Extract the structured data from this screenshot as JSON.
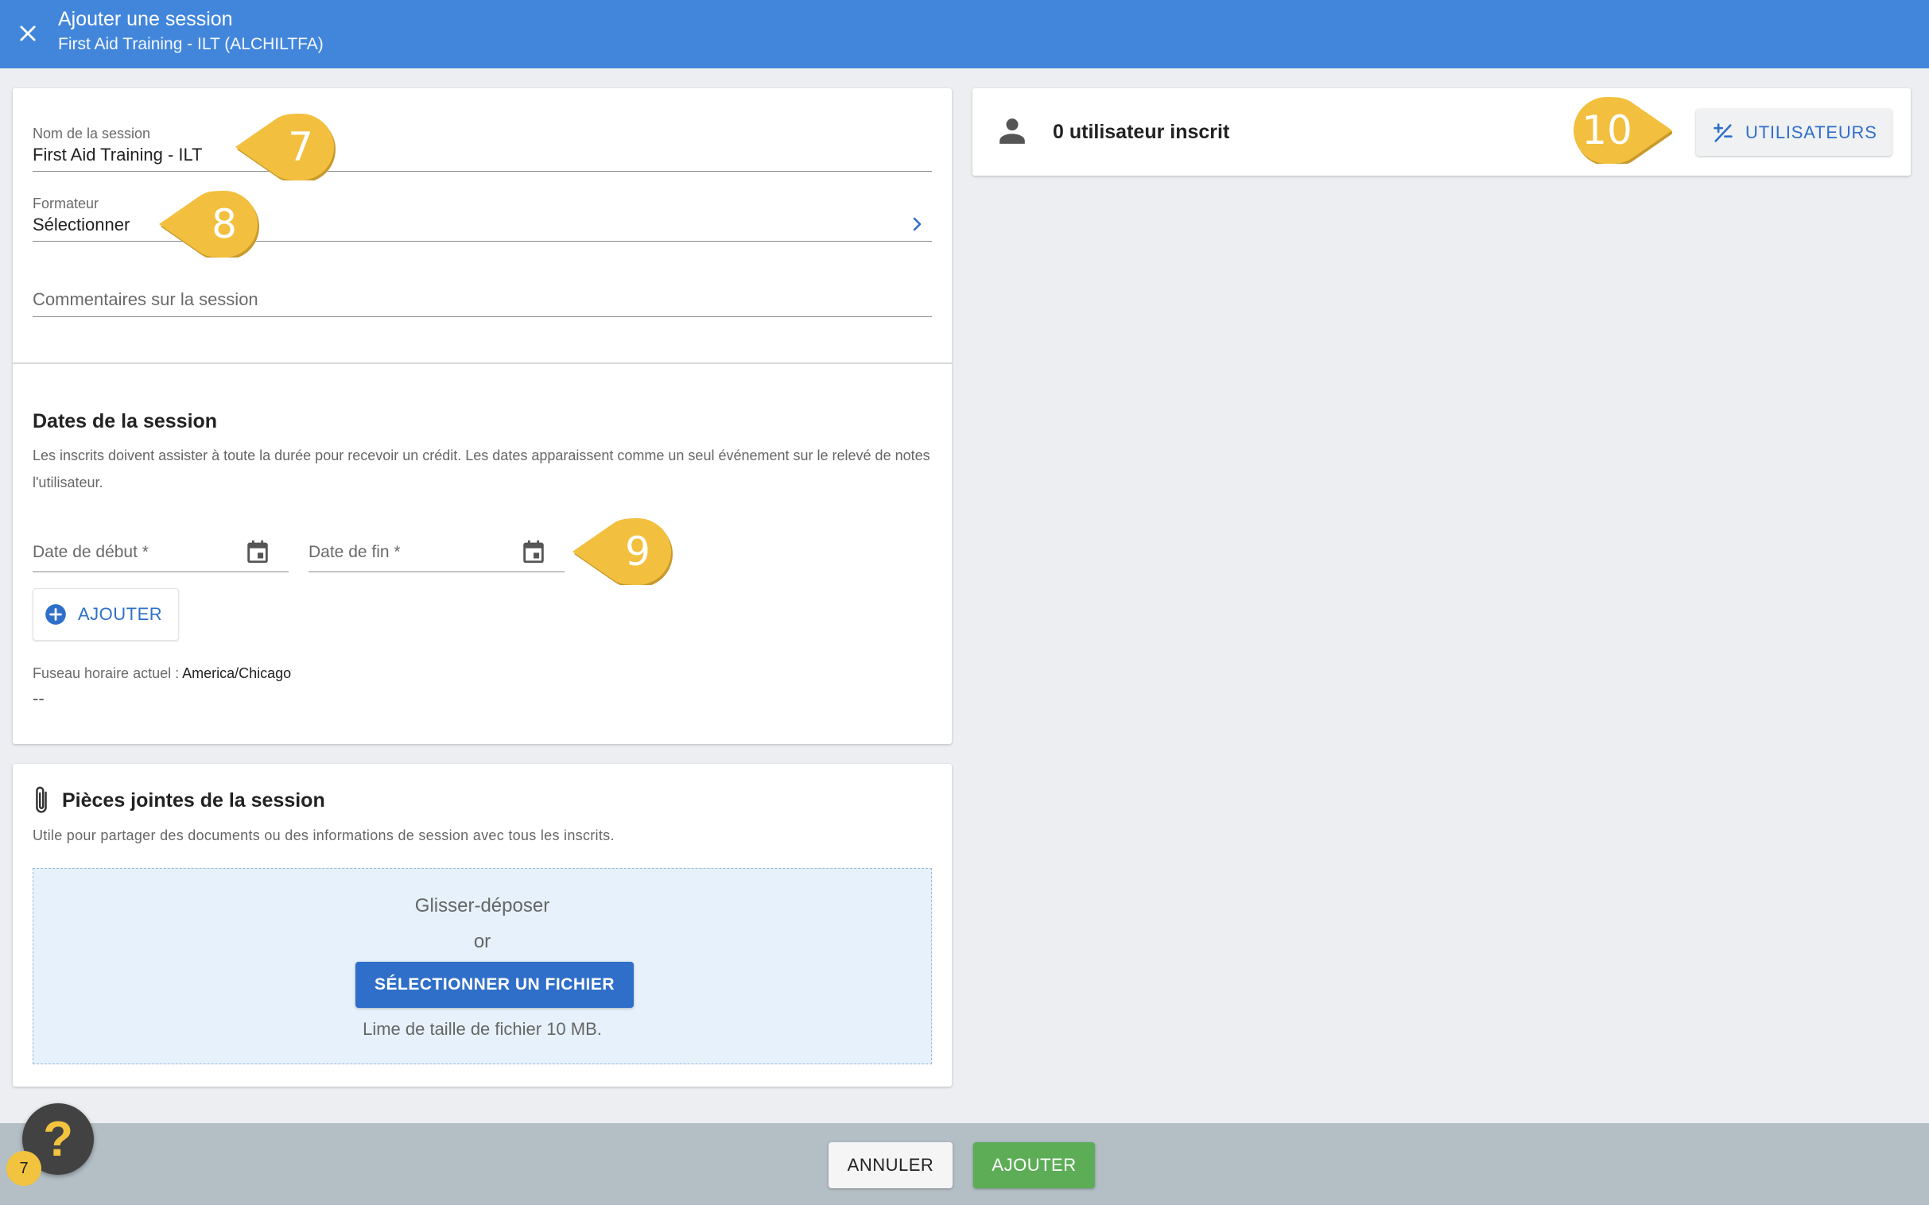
{
  "header": {
    "title": "Ajouter une session",
    "subtitle": "First Aid Training - ILT (ALCHILTFA)",
    "accent_color": "#4286dc"
  },
  "form": {
    "session_name": {
      "label": "Nom de la session",
      "value": "First Aid Training - ILT"
    },
    "trainer": {
      "label": "Formateur",
      "value": "Sélectionner"
    },
    "comments": {
      "placeholder": "Commentaires sur la session"
    }
  },
  "dates": {
    "title": "Dates de la session",
    "description": "Les inscrits doivent assister à toute la durée pour recevoir un crédit. Les dates apparaissent comme un seul événement sur le relevé de notes l'utilisateur.",
    "start_label": "Date de début *",
    "end_label": "Date de fin *",
    "add_label": "AJOUTER",
    "timezone_label": "Fuseau horaire actuel :",
    "timezone_value": "America/Chicago",
    "timezone_dash": "--"
  },
  "attachments": {
    "title": "Pièces jointes de la session",
    "description": "Utile pour partager des documents ou des informations de session avec tous les inscrits.",
    "drop_title": "Glisser-déposer",
    "or": "or",
    "select_button": "SÉLECTIONNER UN FICHIER",
    "limit": "Lime de taille de fichier 10 MB."
  },
  "users": {
    "count_text": "0 utilisateur inscrit",
    "button_label": "UTILISATEURS"
  },
  "callouts": [
    "7",
    "8",
    "9",
    "10"
  ],
  "footer": {
    "cancel_label": "ANNULER",
    "submit_label": "AJOUTER",
    "submit_color": "#5cad56"
  },
  "help": {
    "icon_char": "?",
    "badge": "7"
  }
}
